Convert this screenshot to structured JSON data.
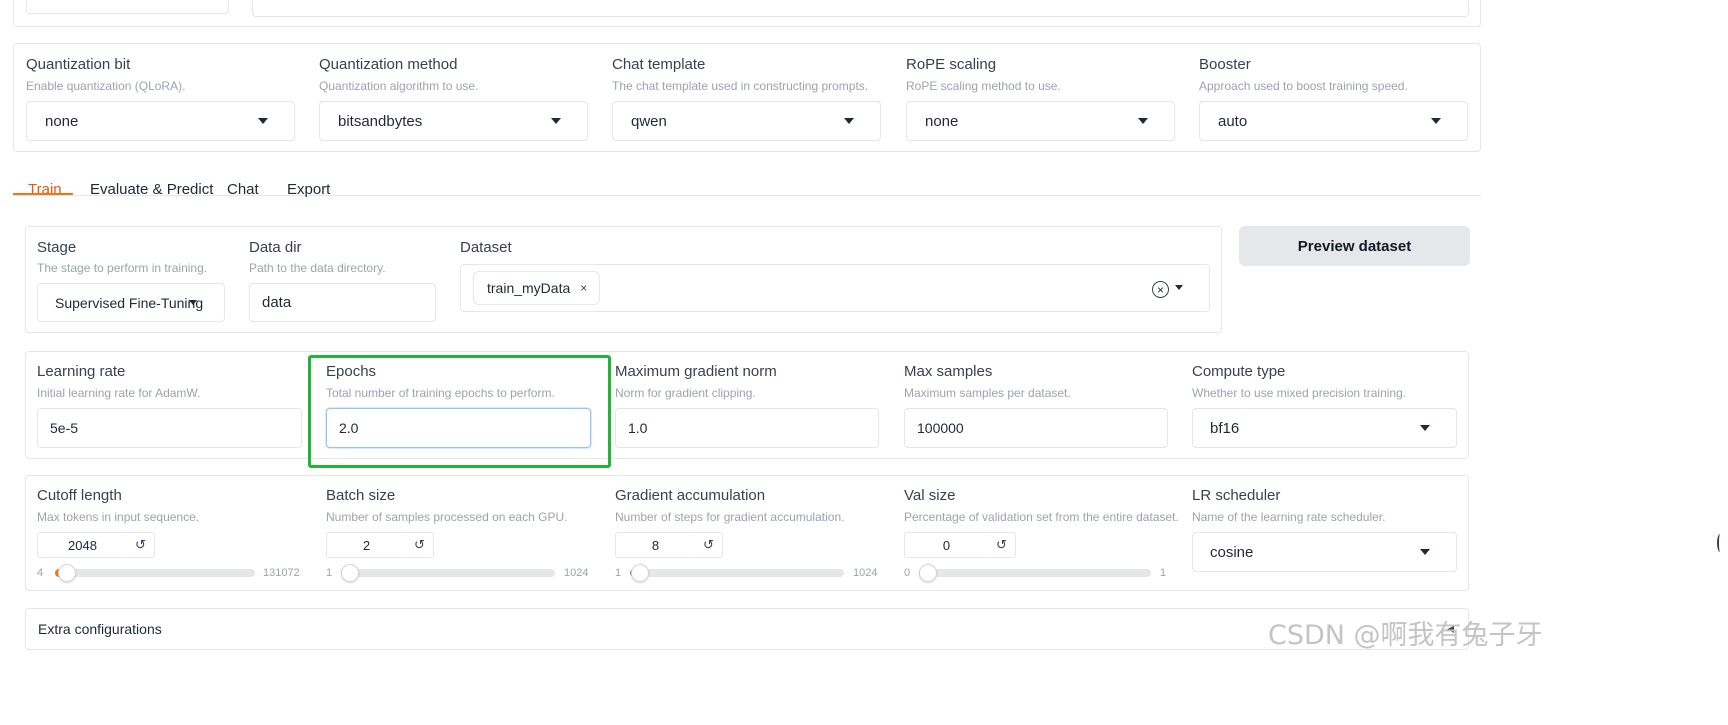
{
  "top_row": {
    "quantization_bit": {
      "label": "Quantization bit",
      "info": "Enable quantization (QLoRA).",
      "value": "none"
    },
    "quantization_method": {
      "label": "Quantization method",
      "info": "Quantization algorithm to use.",
      "value": "bitsandbytes"
    },
    "chat_template": {
      "label": "Chat template",
      "info": "The chat template used in constructing prompts.",
      "value": "qwen"
    },
    "rope_scaling": {
      "label": "RoPE scaling",
      "info": "RoPE scaling method to use.",
      "value": "none"
    },
    "booster": {
      "label": "Booster",
      "info": "Approach used to boost training speed.",
      "value": "auto"
    }
  },
  "tabs": [
    {
      "label": "Train",
      "active": true
    },
    {
      "label": "Evaluate & Predict",
      "active": false
    },
    {
      "label": "Chat",
      "active": false
    },
    {
      "label": "Export",
      "active": false
    }
  ],
  "data_section": {
    "stage": {
      "label": "Stage",
      "info": "The stage to perform in training.",
      "value": "Supervised Fine-Tuning"
    },
    "data_dir": {
      "label": "Data dir",
      "info": "Path to the data directory.",
      "value": "data"
    },
    "dataset": {
      "label": "Dataset",
      "tags": [
        "train_myData"
      ],
      "tag_remove": "×",
      "clear": "×"
    },
    "preview_button": "Preview dataset"
  },
  "hyper_row": {
    "learning_rate": {
      "label": "Learning rate",
      "info": "Initial learning rate for AdamW.",
      "value": "5e-5"
    },
    "epochs": {
      "label": "Epochs",
      "info": "Total number of training epochs to perform.",
      "value": "2.0"
    },
    "max_grad_norm": {
      "label": "Maximum gradient norm",
      "info": "Norm for gradient clipping.",
      "value": "1.0"
    },
    "max_samples": {
      "label": "Max samples",
      "info": "Maximum samples per dataset.",
      "value": "100000"
    },
    "compute_type": {
      "label": "Compute type",
      "info": "Whether to use mixed precision training.",
      "value": "bf16"
    }
  },
  "slider_row": {
    "cutoff_length": {
      "label": "Cutoff length",
      "info": "Max tokens in input sequence.",
      "value": "2048",
      "min": "4",
      "max": "131072",
      "level": 0.0156
    },
    "batch_size": {
      "label": "Batch size",
      "info": "Number of samples processed on each GPU.",
      "value": "2",
      "min": "1",
      "max": "1024",
      "level": 0.001
    },
    "grad_accum": {
      "label": "Gradient accumulation",
      "info": "Number of steps for gradient accumulation.",
      "value": "8",
      "min": "1",
      "max": "1024",
      "level": 0.0068
    },
    "val_size": {
      "label": "Val size",
      "info": "Percentage of validation set from the entire dataset.",
      "value": "0",
      "min": "0",
      "max": "1",
      "level": 0
    },
    "lr_scheduler": {
      "label": "LR scheduler",
      "info": "Name of the learning rate scheduler.",
      "value": "cosine"
    }
  },
  "reset_icon": "↺",
  "extra_config": {
    "label": "Extra configurations",
    "toggle": "◂"
  },
  "watermark": "CSDN @啊我有兔子牙",
  "colors": {
    "accent": "#f97316",
    "highlight_box": "#22b33a",
    "tab_active": "#ea580c"
  }
}
